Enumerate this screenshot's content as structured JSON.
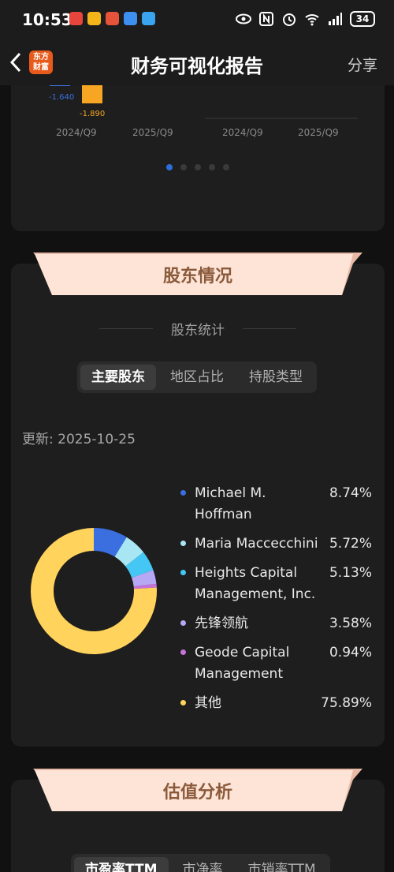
{
  "status": {
    "time": "10:53",
    "battery": "34"
  },
  "nav": {
    "title": "财务可视化报告",
    "share": "分享",
    "logo_line1": "东方",
    "logo_line2": "财富"
  },
  "top_chart": {
    "bar_values": [
      "-1.640",
      "-1.890"
    ],
    "left_axis": [
      "2024/Q9",
      "2025/Q9"
    ],
    "right_axis": [
      "2024/Q9",
      "2025/Q9"
    ],
    "colors": {
      "blue": "#3b6fe0",
      "orange": "#f6a623"
    },
    "pages": 5,
    "active_page": 1
  },
  "shareholders": {
    "section_title": "股东情况",
    "sub_title": "股东统计",
    "tabs": [
      "主要股东",
      "地区占比",
      "持股类型"
    ],
    "active_tab": 0,
    "update_text": "更新: 2025-10-25",
    "items": [
      {
        "name": "Michael M. Hoffman",
        "pct": "8.74%",
        "value": 8.74,
        "color": "#3b6fe0"
      },
      {
        "name": "Maria Maccecchini",
        "pct": "5.72%",
        "value": 5.72,
        "color": "#a8e6f3"
      },
      {
        "name": "Heights Capital Management, Inc.",
        "pct": "5.13%",
        "value": 5.13,
        "color": "#44c7f4"
      },
      {
        "name": "先锋领航",
        "pct": "3.58%",
        "value": 3.58,
        "color": "#b6a8f4"
      },
      {
        "name": "Geode Capital Management",
        "pct": "0.94%",
        "value": 0.94,
        "color": "#c772d8"
      },
      {
        "name": "其他",
        "pct": "75.89%",
        "value": 75.89,
        "color": "#ffd35c"
      }
    ]
  },
  "valuation": {
    "section_title": "估值分析",
    "tabs": [
      "市盈率TTM",
      "市净率",
      "市销率TTM"
    ],
    "active_tab": 0
  }
}
